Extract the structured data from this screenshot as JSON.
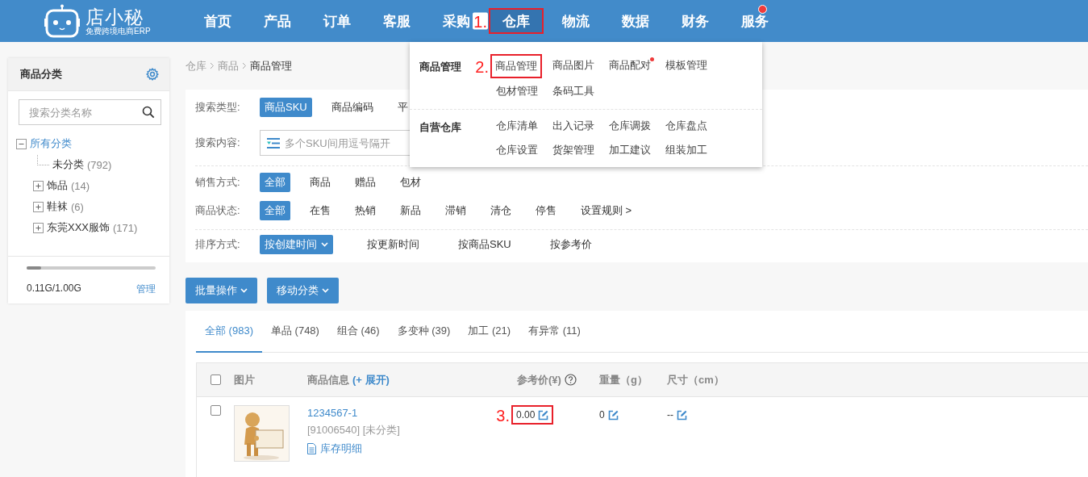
{
  "header": {
    "logo": {
      "name": "店小秘",
      "tagline": "免费跨境电商ERP"
    },
    "nav": [
      {
        "label": "首页",
        "selected": false,
        "dot": false
      },
      {
        "label": "产品",
        "selected": false,
        "dot": false
      },
      {
        "label": "订单",
        "selected": false,
        "dot": false
      },
      {
        "label": "客服",
        "selected": false,
        "dot": false
      },
      {
        "label": "采购",
        "selected": false,
        "dot": false
      },
      {
        "label": "仓库",
        "selected": true,
        "dot": false,
        "annotation": "1."
      },
      {
        "label": "物流",
        "selected": false,
        "dot": false
      },
      {
        "label": "数据",
        "selected": false,
        "dot": false
      },
      {
        "label": "财务",
        "selected": false,
        "dot": false
      },
      {
        "label": "服务",
        "selected": false,
        "dot": true
      }
    ]
  },
  "nav_menu": {
    "groups": [
      {
        "title": "商品管理",
        "items": [
          {
            "label": "商品管理",
            "dot": false,
            "annotation": "2."
          },
          {
            "label": "商品图片",
            "dot": false
          },
          {
            "label": "商品配对",
            "dot": true
          },
          {
            "label": "模板管理",
            "dot": false
          },
          {
            "label": "包材管理",
            "dot": false
          },
          {
            "label": "条码工具",
            "dot": false
          }
        ]
      },
      {
        "title": "自营仓库",
        "items": [
          {
            "label": "仓库清单",
            "dot": false
          },
          {
            "label": "出入记录",
            "dot": false
          },
          {
            "label": "仓库调拨",
            "dot": false
          },
          {
            "label": "仓库盘点",
            "dot": false
          },
          {
            "label": "仓库设置",
            "dot": false
          },
          {
            "label": "货架管理",
            "dot": false
          },
          {
            "label": "加工建议",
            "dot": false
          },
          {
            "label": "组装加工",
            "dot": false
          }
        ]
      }
    ]
  },
  "sidebar": {
    "title": "商品分类",
    "search": {
      "placeholder": "搜索分类名称"
    },
    "tree": [
      {
        "label": "所有分类",
        "expanded": true,
        "children": [
          {
            "label": "未分类",
            "count": "(792)"
          },
          {
            "label": "饰品",
            "count": "(14)",
            "expanded": false
          },
          {
            "label": "鞋袜",
            "count": "(6)",
            "expanded": false
          },
          {
            "label": "东莞XXX服饰",
            "count": "(171)",
            "expanded": false
          }
        ]
      }
    ],
    "storage": {
      "level": 0.11,
      "reading": "0.11G/1.00G",
      "link": "管理"
    }
  },
  "breadcrumb": [
    "仓库",
    "商品",
    "商品管理"
  ],
  "filters": {
    "groups": [
      [
        {
          "label": "搜索类型:",
          "kind": "options",
          "options": [
            {
              "label": "商品SKU",
              "selected": true
            },
            {
              "label": "商品编码",
              "selected": false
            },
            {
              "label": "平",
              "selected": false
            }
          ]
        },
        {
          "label": "搜索内容:",
          "kind": "input",
          "placeholder": "多个SKU间用逗号隔开"
        }
      ],
      [
        {
          "label": "销售方式:",
          "kind": "options",
          "options": [
            {
              "label": "全部",
              "selected": true
            },
            {
              "label": "商品",
              "selected": false
            },
            {
              "label": "赠品",
              "selected": false
            },
            {
              "label": "包材",
              "selected": false
            }
          ]
        },
        {
          "label": "商品状态:",
          "kind": "options",
          "options": [
            {
              "label": "全部",
              "selected": true
            },
            {
              "label": "在售",
              "selected": false
            },
            {
              "label": "热销",
              "selected": false
            },
            {
              "label": "新品",
              "selected": false
            },
            {
              "label": "滞销",
              "selected": false
            },
            {
              "label": "清仓",
              "selected": false
            },
            {
              "label": "停售",
              "selected": false
            },
            {
              "label": "设置规则 >",
              "selected": false
            }
          ]
        }
      ],
      [
        {
          "label": "排序方式:",
          "kind": "sort",
          "options": [
            {
              "label": "按创建时间",
              "selected": true
            },
            {
              "label": "按更新时间",
              "selected": false
            },
            {
              "label": "按商品SKU",
              "selected": false
            },
            {
              "label": "按参考价",
              "selected": false
            }
          ]
        }
      ]
    ]
  },
  "actions": [
    "批量操作",
    "移动分类"
  ],
  "tabs": [
    {
      "label": "全部 (983)",
      "selected": true
    },
    {
      "label": "单品 (748)",
      "selected": false
    },
    {
      "label": "组合 (46)",
      "selected": false
    },
    {
      "label": "多变种 (39)",
      "selected": false
    },
    {
      "label": "加工 (21)",
      "selected": false
    },
    {
      "label": "有异常 (11)",
      "selected": false
    }
  ],
  "table": {
    "columns": [
      {
        "kind": "checkbox",
        "checked": false
      },
      {
        "kind": "text",
        "label": "图片"
      },
      {
        "kind": "text",
        "label": "商品信息",
        "link": "(+ 展开)"
      },
      {
        "kind": "help",
        "label": "参考价(¥)"
      },
      {
        "kind": "text",
        "label": "重量（g）"
      },
      {
        "kind": "text",
        "label": "尺寸（cm）"
      }
    ],
    "rows": [
      {
        "checked": false,
        "sku": "1234567-1",
        "code": "[91006540] [未分类]",
        "stock_link": "库存明细",
        "price": {
          "value": "0.00",
          "annotation": "3."
        },
        "weight": "0",
        "size": "--"
      }
    ]
  }
}
